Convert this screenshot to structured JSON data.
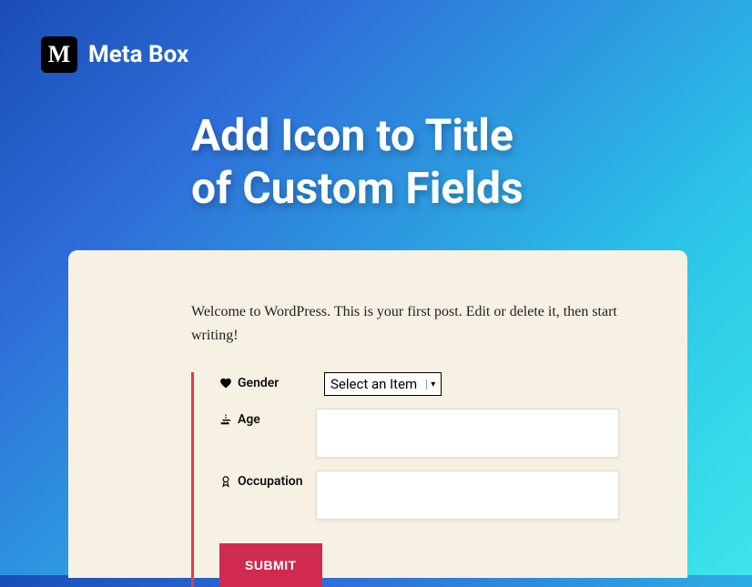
{
  "brand": {
    "logo_letter": "M",
    "name": "Meta Box"
  },
  "page": {
    "title_line1": "Add Icon to Title",
    "title_line2": "of Custom Fields"
  },
  "card": {
    "intro": "Welcome to WordPress. This is your first post. Edit or delete it, then start writing!",
    "fields": {
      "gender": {
        "label": "Gender",
        "select_value": "Select an Item"
      },
      "age": {
        "label": "Age",
        "value": ""
      },
      "occupation": {
        "label": "Occupation",
        "value": ""
      }
    },
    "submit_label": "SUBMIT"
  }
}
